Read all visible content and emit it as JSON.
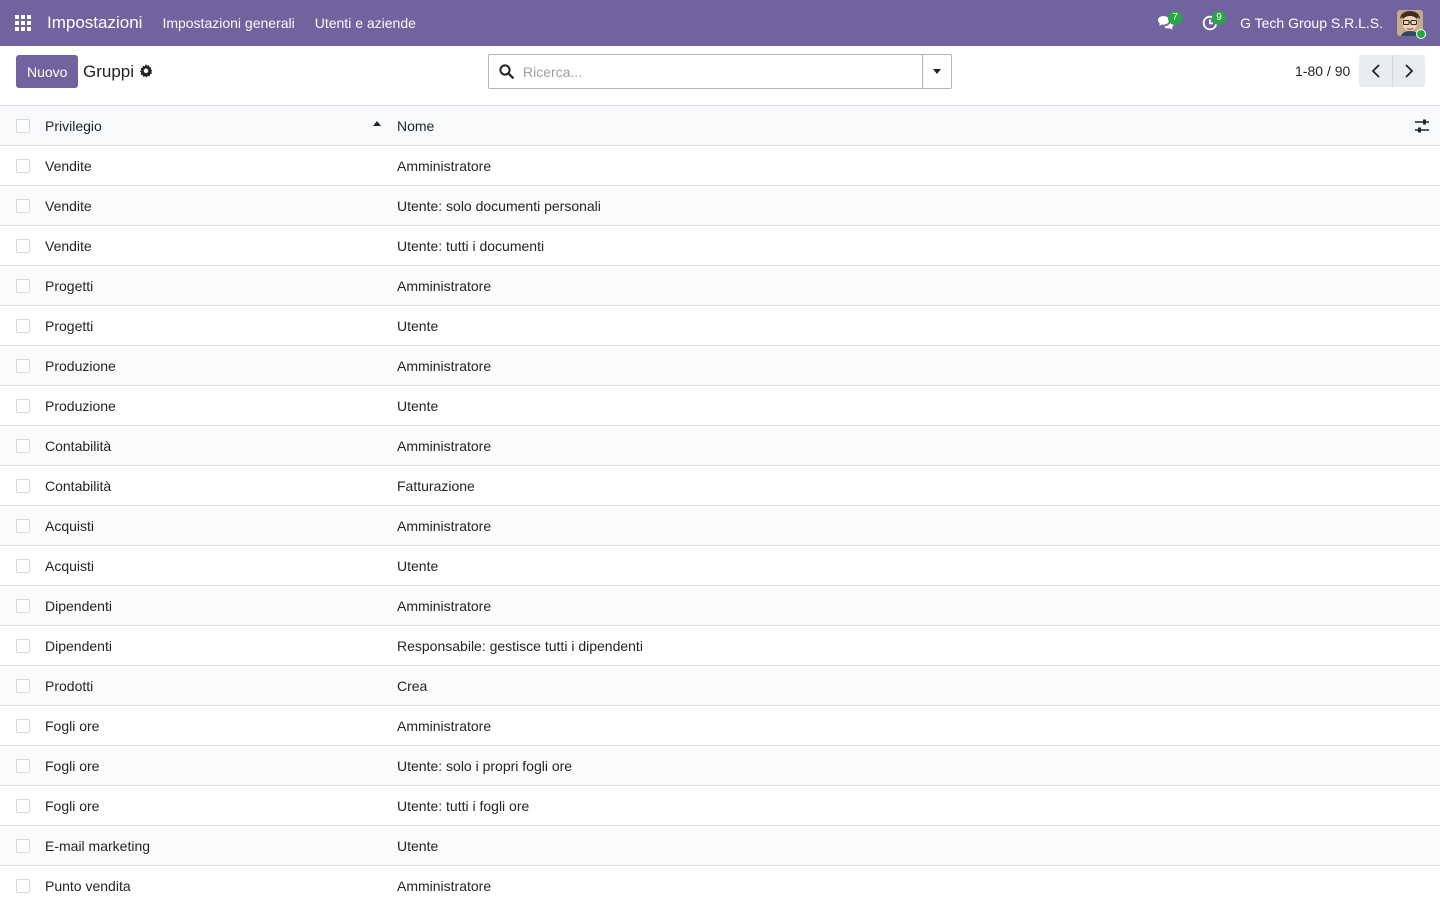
{
  "navbar": {
    "app_title": "Impostazioni",
    "menus": [
      "Impostazioni generali",
      "Utenti e aziende"
    ],
    "messages_count": "7",
    "activities_count": "9",
    "company": "G Tech Group S.R.L.S.",
    "accent": "#71639e"
  },
  "control_panel": {
    "new_label": "Nuovo",
    "title": "Gruppi",
    "search_placeholder": "Ricerca...",
    "pager": "1-80 / 90"
  },
  "table": {
    "columns": [
      "Privilegio",
      "Nome"
    ],
    "rows": [
      {
        "privilegio": "Vendite",
        "nome": "Amministratore"
      },
      {
        "privilegio": "Vendite",
        "nome": "Utente: solo documenti personali"
      },
      {
        "privilegio": "Vendite",
        "nome": "Utente: tutti i documenti"
      },
      {
        "privilegio": "Progetti",
        "nome": "Amministratore"
      },
      {
        "privilegio": "Progetti",
        "nome": "Utente"
      },
      {
        "privilegio": "Produzione",
        "nome": "Amministratore"
      },
      {
        "privilegio": "Produzione",
        "nome": "Utente"
      },
      {
        "privilegio": "Contabilità",
        "nome": "Amministratore"
      },
      {
        "privilegio": "Contabilità",
        "nome": "Fatturazione"
      },
      {
        "privilegio": "Acquisti",
        "nome": "Amministratore"
      },
      {
        "privilegio": "Acquisti",
        "nome": "Utente"
      },
      {
        "privilegio": "Dipendenti",
        "nome": "Amministratore"
      },
      {
        "privilegio": "Dipendenti",
        "nome": "Responsabile: gestisce tutti i dipendenti"
      },
      {
        "privilegio": "Prodotti",
        "nome": "Crea"
      },
      {
        "privilegio": "Fogli ore",
        "nome": "Amministratore"
      },
      {
        "privilegio": "Fogli ore",
        "nome": "Utente: solo i propri fogli ore"
      },
      {
        "privilegio": "Fogli ore",
        "nome": "Utente: tutti i fogli ore"
      },
      {
        "privilegio": "E-mail marketing",
        "nome": "Utente"
      },
      {
        "privilegio": "Punto vendita",
        "nome": "Amministratore"
      }
    ]
  }
}
